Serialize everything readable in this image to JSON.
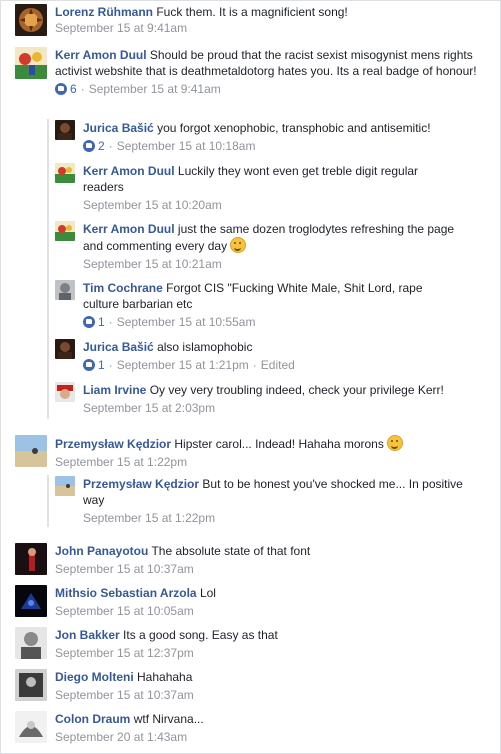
{
  "comments": [
    {
      "name": "Lorenz Rühmann",
      "text": "Fuck them. It is a magnificient song!",
      "time": "September 15 at 9:41am"
    },
    {
      "name": "Kerr Amon Duul",
      "text": "Should be proud that the racist sexist misogynist mens rights activist webshite that is deathmetaldotorg hates you. Its a real badge of honour!",
      "likes": "6",
      "time": "September 15 at 9:41am"
    },
    {
      "name": "Przemysław Kędzior",
      "text": "Hipster carol... Indead! Hahaha morons",
      "time": "September 15 at 1:22pm"
    },
    {
      "name": "John Panayotou",
      "text": "The absolute state of that font",
      "time": "September 15 at 10:37am"
    },
    {
      "name": "Mithsio Sebastian Arzola",
      "text": "Lol",
      "time": "September 15 at 10:05am"
    },
    {
      "name": "Jon Bakker",
      "text": "Its a good song. Easy as that",
      "time": "September 15 at 12:37pm"
    },
    {
      "name": "Diego Molteni",
      "text": "Hahahaha",
      "time": "September 15 at 10:37am"
    },
    {
      "name": "Colon Draum",
      "text": "wtf Nirvana...",
      "time": "September 20 at 1:43am"
    }
  ],
  "replies": [
    {
      "name": "Jurica Bašić",
      "text": "you forgot xenophobic, transphobic and antisemitic!",
      "likes": "2",
      "time": "September 15 at 10:18am"
    },
    {
      "name": "Kerr Amon Duul",
      "text": "Luckily they wont even get treble digit regular readers",
      "time": "September 15 at 10:20am"
    },
    {
      "name": "Kerr Amon Duul",
      "text": "just the same dozen troglodytes refreshing the page and commenting every day",
      "time": "September 15 at 10:21am"
    },
    {
      "name": "Tim Cochrane",
      "text": "Forgot CIS \"Fucking White Male, Shit Lord, rape culture barbarian etc",
      "likes": "1",
      "time": "September 15 at 10:55am"
    },
    {
      "name": "Jurica Bašić",
      "text": "also islamophobic",
      "likes": "1",
      "time": "September 15 at 1:21pm",
      "edited": "Edited"
    },
    {
      "name": "Liam Irvine",
      "text": "Oy vey very troubling indeed, check your privilege Kerr!",
      "time": "September 15 at 2:03pm"
    },
    {
      "name": "Przemysław Kędzior",
      "text": "But to be honest you've shocked me... In positive way",
      "time": "September 15 at 1:22pm"
    }
  ],
  "colors": {
    "link": "#365899",
    "meta": "#90949c",
    "like": "#4267b2",
    "border": "#dddfe2"
  },
  "icons": [
    "like-icon",
    "grin-emoji-icon",
    "smile-emoji-icon"
  ]
}
